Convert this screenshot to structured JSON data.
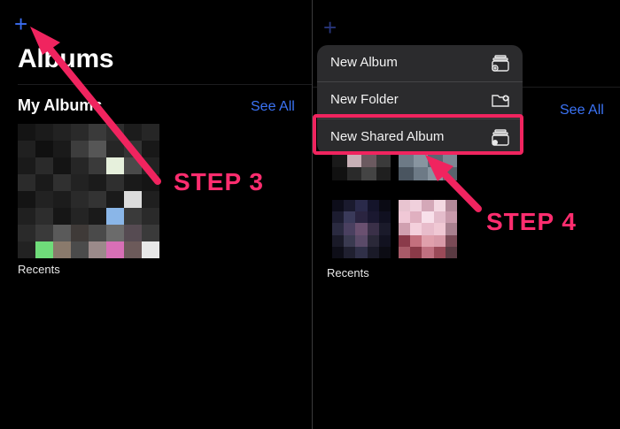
{
  "left": {
    "add_icon": "plus-icon",
    "title": "Albums",
    "section_title": "My Albums",
    "see_all": "See All",
    "album_caption": "Recents"
  },
  "right": {
    "add_icon": "plus-icon",
    "see_all": "See All",
    "album_caption": "Recents",
    "menu": [
      {
        "label": "New Album",
        "icon": "album-stack-icon"
      },
      {
        "label": "New Folder",
        "icon": "folder-add-icon"
      },
      {
        "label": "New Shared Album",
        "icon": "shared-album-icon"
      }
    ]
  },
  "annotations": {
    "step3": "STEP 3",
    "step4": "STEP 4",
    "accent_color": "#f0245f"
  }
}
